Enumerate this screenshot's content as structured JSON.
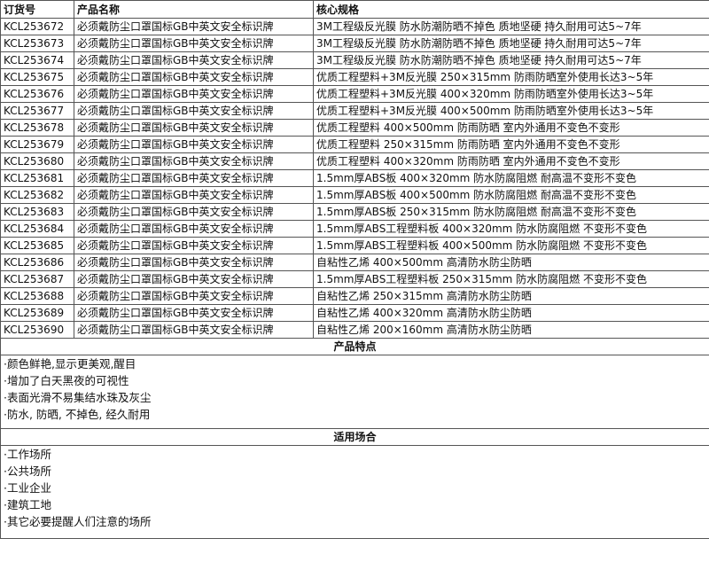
{
  "headers": {
    "code": "订货号",
    "name": "产品名称",
    "spec": "核心规格"
  },
  "rows": [
    {
      "code": "KCL253672",
      "name": "必须戴防尘口罩国标GB中英文安全标识牌",
      "spec": "3M工程级反光膜 防水防潮防晒不掉色 质地坚硬 持久耐用可达5~7年"
    },
    {
      "code": "KCL253673",
      "name": "必须戴防尘口罩国标GB中英文安全标识牌",
      "spec": "3M工程级反光膜 防水防潮防晒不掉色 质地坚硬 持久耐用可达5~7年"
    },
    {
      "code": "KCL253674",
      "name": "必须戴防尘口罩国标GB中英文安全标识牌",
      "spec": "3M工程级反光膜 防水防潮防晒不掉色 质地坚硬 持久耐用可达5~7年"
    },
    {
      "code": "KCL253675",
      "name": "必须戴防尘口罩国标GB中英文安全标识牌",
      "spec": "优质工程塑料+3M反光膜 250×315mm 防雨防晒室外使用长达3~5年"
    },
    {
      "code": "KCL253676",
      "name": "必须戴防尘口罩国标GB中英文安全标识牌",
      "spec": "优质工程塑料+3M反光膜 400×320mm 防雨防晒室外使用长达3~5年"
    },
    {
      "code": "KCL253677",
      "name": "必须戴防尘口罩国标GB中英文安全标识牌",
      "spec": "优质工程塑料+3M反光膜 400×500mm 防雨防晒室外使用长达3~5年"
    },
    {
      "code": "KCL253678",
      "name": "必须戴防尘口罩国标GB中英文安全标识牌",
      "spec": "优质工程塑料 400×500mm 防雨防晒 室内外通用不变色不变形"
    },
    {
      "code": "KCL253679",
      "name": "必须戴防尘口罩国标GB中英文安全标识牌",
      "spec": "优质工程塑料 250×315mm 防雨防晒 室内外通用不变色不变形"
    },
    {
      "code": "KCL253680",
      "name": "必须戴防尘口罩国标GB中英文安全标识牌",
      "spec": "优质工程塑料 400×320mm 防雨防晒 室内外通用不变色不变形"
    },
    {
      "code": "KCL253681",
      "name": "必须戴防尘口罩国标GB中英文安全标识牌",
      "spec": "1.5mm厚ABS板 400×320mm 防水防腐阻燃 耐高温不变形不变色"
    },
    {
      "code": "KCL253682",
      "name": "必须戴防尘口罩国标GB中英文安全标识牌",
      "spec": "1.5mm厚ABS板 400×500mm 防水防腐阻燃 耐高温不变形不变色"
    },
    {
      "code": "KCL253683",
      "name": "必须戴防尘口罩国标GB中英文安全标识牌",
      "spec": "1.5mm厚ABS板 250×315mm 防水防腐阻燃 耐高温不变形不变色"
    },
    {
      "code": "KCL253684",
      "name": "必须戴防尘口罩国标GB中英文安全标识牌",
      "spec": "1.5mm厚ABS工程塑料板 400×320mm 防水防腐阻燃 不变形不变色"
    },
    {
      "code": "KCL253685",
      "name": "必须戴防尘口罩国标GB中英文安全标识牌",
      "spec": "1.5mm厚ABS工程塑料板 400×500mm 防水防腐阻燃 不变形不变色"
    },
    {
      "code": "KCL253686",
      "name": "必须戴防尘口罩国标GB中英文安全标识牌",
      "spec": "自粘性乙烯 400×500mm 高清防水防尘防晒"
    },
    {
      "code": "KCL253687",
      "name": "必须戴防尘口罩国标GB中英文安全标识牌",
      "spec": "1.5mm厚ABS工程塑料板 250×315mm 防水防腐阻燃 不变形不变色"
    },
    {
      "code": "KCL253688",
      "name": "必须戴防尘口罩国标GB中英文安全标识牌",
      "spec": "自粘性乙烯 250×315mm 高清防水防尘防晒"
    },
    {
      "code": "KCL253689",
      "name": "必须戴防尘口罩国标GB中英文安全标识牌",
      "spec": "自粘性乙烯 400×320mm 高清防水防尘防晒"
    },
    {
      "code": "KCL253690",
      "name": "必须戴防尘口罩国标GB中英文安全标识牌",
      "spec": "自粘性乙烯 200×160mm 高清防水防尘防晒"
    }
  ],
  "features": {
    "title": "产品特点",
    "items": [
      "·颜色鲜艳,显示更美观,醒目",
      "·增加了白天黑夜的可视性",
      "·表面光滑不易集结水珠及灰尘",
      "·防水, 防晒, 不掉色, 经久耐用"
    ]
  },
  "places": {
    "title": "适用场合",
    "items": [
      "·工作场所",
      "·公共场所",
      "·工业企业",
      "·建筑工地",
      "·其它必要提醒人们注意的场所"
    ]
  }
}
